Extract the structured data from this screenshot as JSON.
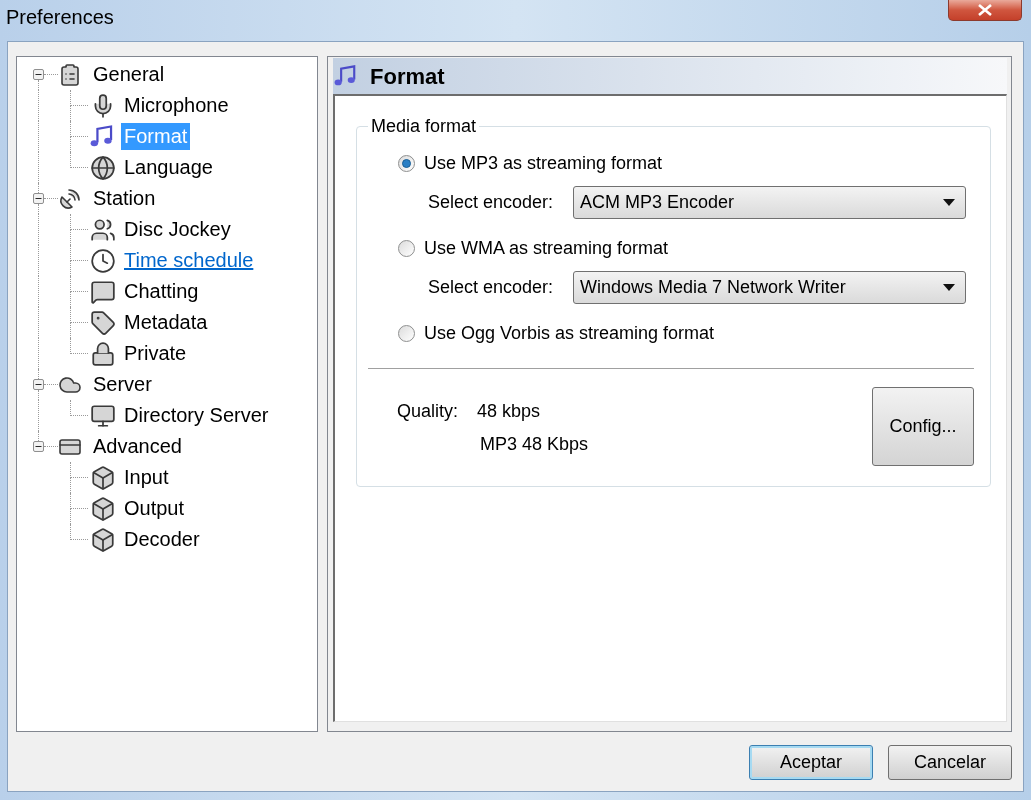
{
  "window": {
    "title": "Preferences"
  },
  "tree": [
    {
      "label": "General",
      "expanded": true,
      "selected": false,
      "hovered": false,
      "children": [
        {
          "label": "Microphone",
          "selected": false,
          "hovered": false
        },
        {
          "label": "Format",
          "selected": true,
          "hovered": false
        },
        {
          "label": "Language",
          "selected": false,
          "hovered": false
        }
      ]
    },
    {
      "label": "Station",
      "expanded": true,
      "selected": false,
      "hovered": false,
      "children": [
        {
          "label": "Disc Jockey",
          "selected": false,
          "hovered": false
        },
        {
          "label": "Time schedule",
          "selected": false,
          "hovered": true
        },
        {
          "label": "Chatting",
          "selected": false,
          "hovered": false
        },
        {
          "label": "Metadata",
          "selected": false,
          "hovered": false
        },
        {
          "label": "Private",
          "selected": false,
          "hovered": false
        }
      ]
    },
    {
      "label": "Server",
      "expanded": true,
      "selected": false,
      "hovered": false,
      "children": [
        {
          "label": "Directory Server",
          "selected": false,
          "hovered": false
        }
      ]
    },
    {
      "label": "Advanced",
      "expanded": true,
      "selected": false,
      "hovered": false,
      "children": [
        {
          "label": "Input",
          "selected": false,
          "hovered": false
        },
        {
          "label": "Output",
          "selected": false,
          "hovered": false
        },
        {
          "label": "Decoder",
          "selected": false,
          "hovered": false
        }
      ]
    }
  ],
  "format_panel": {
    "title": "Format",
    "group": {
      "label": "Media format",
      "options": [
        {
          "label": "Use MP3 as streaming format",
          "selected": true,
          "encoder": {
            "label": "Select encoder:",
            "value": "ACM MP3 Encoder"
          }
        },
        {
          "label": "Use WMA as streaming format",
          "selected": false,
          "encoder": {
            "label": "Select encoder:",
            "value": "Windows Media 7 Network Writer"
          }
        },
        {
          "label": "Use Ogg Vorbis as streaming format",
          "selected": false
        }
      ],
      "quality": {
        "label": "Quality:",
        "value": "48 kbps",
        "detail": "MP3 48 Kbps"
      },
      "config_button": "Config..."
    }
  },
  "buttons": [
    {
      "label": "Aceptar",
      "default": true
    },
    {
      "label": "Cancelar",
      "default": false
    }
  ]
}
